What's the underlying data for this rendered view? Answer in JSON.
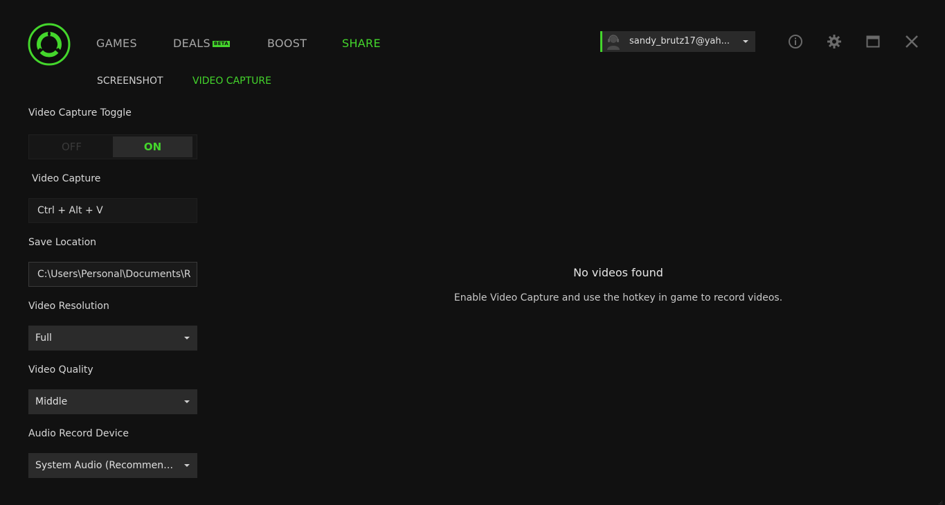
{
  "nav": {
    "games": "GAMES",
    "deals": "DEALS",
    "deals_badge": "BETA",
    "boost": "BOOST",
    "share": "SHARE"
  },
  "subnav": {
    "screenshot": "SCREENSHOT",
    "video_capture": "VIDEO CAPTURE"
  },
  "account": {
    "email": "sandy_brutz17@yah..."
  },
  "settings": {
    "toggle_label": "Video Capture Toggle",
    "toggle_off": "OFF",
    "toggle_on": "ON",
    "hotkey_label": "Video Capture",
    "hotkey_value": "Ctrl + Alt + V",
    "save_label": "Save Location",
    "save_value": "C:\\Users\\Personal\\Documents\\R",
    "resolution_label": "Video Resolution",
    "resolution_value": "Full",
    "quality_label": "Video Quality",
    "quality_value": "Middle",
    "audio_label": "Audio Record Device",
    "audio_value": "System Audio (Recommended)"
  },
  "empty": {
    "title": "No videos found",
    "message": "Enable Video Capture and use the hotkey in game to record videos."
  },
  "colors": {
    "accent": "#44d62c",
    "background": "#111111"
  },
  "icons": [
    "logo-icon",
    "avatar-icon",
    "info-icon",
    "gear-icon",
    "maximize-icon",
    "close-icon",
    "resize-grip-icon"
  ]
}
